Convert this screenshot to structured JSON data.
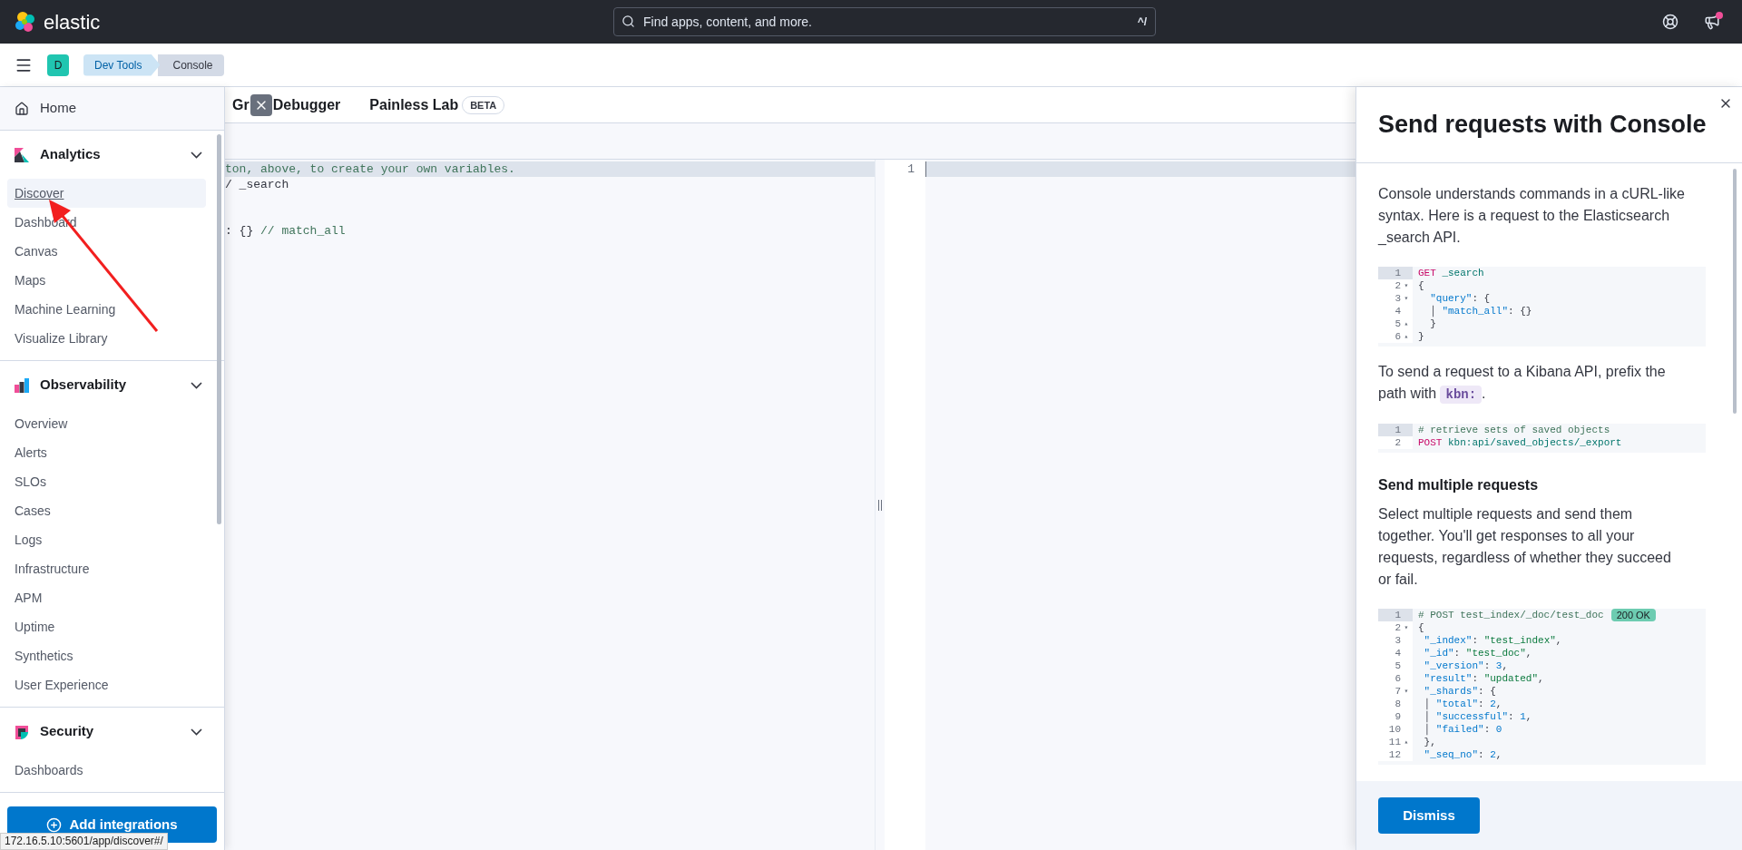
{
  "header": {
    "brand": "elastic",
    "search": {
      "placeholder": "Find apps, content, and more.",
      "shortcut": "^/"
    },
    "news_unread": true
  },
  "breadcrumbs": {
    "avatar": "D",
    "items": [
      {
        "label": "Dev Tools",
        "current": false
      },
      {
        "label": "Console",
        "current": true
      }
    ]
  },
  "sidebar": {
    "home": "Home",
    "sections": [
      {
        "title": "Analytics",
        "kind": "analytics",
        "expanded": true,
        "items": [
          {
            "label": "Discover",
            "selected": true
          },
          {
            "label": "Dashboard",
            "selected": false
          },
          {
            "label": "Canvas",
            "selected": false
          },
          {
            "label": "Maps",
            "selected": false
          },
          {
            "label": "Machine Learning",
            "selected": false
          },
          {
            "label": "Visualize Library",
            "selected": false
          }
        ]
      },
      {
        "title": "Observability",
        "kind": "observability",
        "expanded": true,
        "items": [
          {
            "label": "Overview",
            "selected": false
          },
          {
            "label": "Alerts",
            "selected": false
          },
          {
            "label": "SLOs",
            "selected": false
          },
          {
            "label": "Cases",
            "selected": false
          },
          {
            "label": "Logs",
            "selected": false
          },
          {
            "label": "Infrastructure",
            "selected": false
          },
          {
            "label": "APM",
            "selected": false
          },
          {
            "label": "Uptime",
            "selected": false
          },
          {
            "label": "Synthetics",
            "selected": false
          },
          {
            "label": "User Experience",
            "selected": false
          }
        ]
      },
      {
        "title": "Security",
        "kind": "security",
        "expanded": true,
        "items": [
          {
            "label": "Dashboards",
            "selected": false
          }
        ]
      }
    ],
    "add_button": "Add integrations",
    "status_url": "172.16.5.10:5601/app/discover#/"
  },
  "tabs": [
    {
      "label_start": "Gr",
      "label_end": "Debugger",
      "selected": false
    },
    {
      "label": "Painless Lab",
      "badge": "BETA",
      "selected": false
    }
  ],
  "editor": {
    "request_lines": [
      {
        "active": true,
        "tokens": [
          {
            "kind": "comment",
            "text": "ton, above, to create your own variables."
          }
        ]
      },
      {
        "active": false,
        "tokens": [
          {
            "kind": "plain",
            "text": "/ _search"
          }
        ]
      },
      {
        "active": false
      },
      {
        "active": false
      },
      {
        "active": false,
        "tokens": [
          {
            "kind": "plain",
            "text": ": {} "
          },
          {
            "kind": "comment",
            "text": "// match_all"
          }
        ]
      }
    ],
    "response_lines": [
      {
        "num": "1",
        "active": true
      }
    ]
  },
  "flyout": {
    "title": "Send requests with Console",
    "blocks": [
      {
        "kind": "paragraph",
        "text": "Console understands commands in a cURL-like syntax. Here is a request to the Elasticsearch _search API."
      },
      {
        "kind": "code",
        "lines": [
          {
            "num": "1",
            "active": true,
            "tokens": [
              {
                "kind": "method",
                "text": "GET"
              },
              {
                "kind": "path",
                "text": " _search"
              }
            ]
          },
          {
            "num": "2",
            "fold": "▾",
            "active": false,
            "tokens": [
              {
                "kind": "plain",
                "text": "{"
              }
            ]
          },
          {
            "num": "3",
            "fold": "▾",
            "active": false,
            "tokens": [
              {
                "kind": "key",
                "text": "  \"query\""
              },
              {
                "kind": "plain",
                "text": ": {"
              }
            ]
          },
          {
            "num": "4",
            "active": false,
            "tokens": [
              {
                "kind": "plain",
                "text": "  │ "
              },
              {
                "kind": "key",
                "text": "\"match_all\""
              },
              {
                "kind": "plain",
                "text": ": {}"
              }
            ]
          },
          {
            "num": "5",
            "fold": "▴",
            "active": false,
            "tokens": [
              {
                "kind": "plain",
                "text": "  }"
              }
            ]
          },
          {
            "num": "6",
            "fold": "▴",
            "active": false,
            "tokens": [
              {
                "kind": "plain",
                "text": "}"
              }
            ]
          }
        ]
      },
      {
        "kind": "paragraph_code",
        "before": "To send a request to a Kibana API, prefix the path with ",
        "code": "kbn:",
        "after": "."
      },
      {
        "kind": "code",
        "lines": [
          {
            "num": "1",
            "active": true,
            "tokens": [
              {
                "kind": "comment",
                "text": "# retrieve sets of saved objects"
              }
            ]
          },
          {
            "num": "2",
            "active": false,
            "tokens": [
              {
                "kind": "method",
                "text": "POST"
              },
              {
                "kind": "path",
                "text": " kbn:api/saved_objects/_export"
              }
            ]
          }
        ]
      },
      {
        "kind": "heading",
        "text": "Send multiple requests"
      },
      {
        "kind": "paragraph",
        "text": "Select multiple requests and send them together. You'll get responses to all your requests, regardless of whether they succeed or fail."
      },
      {
        "kind": "code",
        "lines": [
          {
            "num": "1",
            "active": true,
            "tokens": [
              {
                "kind": "comment",
                "text": "# POST test_index/_doc/test_doc"
              }
            ],
            "badge": "200 OK"
          },
          {
            "num": "2",
            "fold": "▾",
            "active": false,
            "tokens": [
              {
                "kind": "plain",
                "text": "{"
              }
            ]
          },
          {
            "num": "3",
            "active": false,
            "tokens": [
              {
                "kind": "key",
                "text": " \"_index\""
              },
              {
                "kind": "plain",
                "text": ": "
              },
              {
                "kind": "string",
                "text": "\"test_index\""
              },
              {
                "kind": "plain",
                "text": ","
              }
            ]
          },
          {
            "num": "4",
            "active": false,
            "tokens": [
              {
                "kind": "key",
                "text": " \"_id\""
              },
              {
                "kind": "plain",
                "text": ": "
              },
              {
                "kind": "string",
                "text": "\"test_doc\""
              },
              {
                "kind": "plain",
                "text": ","
              }
            ]
          },
          {
            "num": "5",
            "active": false,
            "tokens": [
              {
                "kind": "key",
                "text": " \"_version\""
              },
              {
                "kind": "plain",
                "text": ": "
              },
              {
                "kind": "number",
                "text": "3"
              },
              {
                "kind": "plain",
                "text": ","
              }
            ]
          },
          {
            "num": "6",
            "active": false,
            "tokens": [
              {
                "kind": "key",
                "text": " \"result\""
              },
              {
                "kind": "plain",
                "text": ": "
              },
              {
                "kind": "string",
                "text": "\"updated\""
              },
              {
                "kind": "plain",
                "text": ","
              }
            ]
          },
          {
            "num": "7",
            "fold": "▾",
            "active": false,
            "tokens": [
              {
                "kind": "key",
                "text": " \"_shards\""
              },
              {
                "kind": "plain",
                "text": ": {"
              }
            ]
          },
          {
            "num": "8",
            "active": false,
            "tokens": [
              {
                "kind": "plain",
                "text": " │ "
              },
              {
                "kind": "key",
                "text": "\"total\""
              },
              {
                "kind": "plain",
                "text": ": "
              },
              {
                "kind": "number",
                "text": "2"
              },
              {
                "kind": "plain",
                "text": ","
              }
            ]
          },
          {
            "num": "9",
            "active": false,
            "tokens": [
              {
                "kind": "plain",
                "text": " │ "
              },
              {
                "kind": "key",
                "text": "\"successful\""
              },
              {
                "kind": "plain",
                "text": ": "
              },
              {
                "kind": "number",
                "text": "1"
              },
              {
                "kind": "plain",
                "text": ","
              }
            ]
          },
          {
            "num": "10",
            "active": false,
            "tokens": [
              {
                "kind": "plain",
                "text": " │ "
              },
              {
                "kind": "key",
                "text": "\"failed\""
              },
              {
                "kind": "plain",
                "text": ": "
              },
              {
                "kind": "number",
                "text": "0"
              }
            ]
          },
          {
            "num": "11",
            "fold": "▴",
            "active": false,
            "tokens": [
              {
                "kind": "plain",
                "text": " },"
              }
            ]
          },
          {
            "num": "12",
            "active": false,
            "tokens": [
              {
                "kind": "key",
                "text": " \"_seq_no\""
              },
              {
                "kind": "plain",
                "text": ": "
              },
              {
                "kind": "number",
                "text": "2"
              },
              {
                "kind": "plain",
                "text": ","
              }
            ]
          }
        ]
      }
    ],
    "dismiss": "Dismiss"
  }
}
